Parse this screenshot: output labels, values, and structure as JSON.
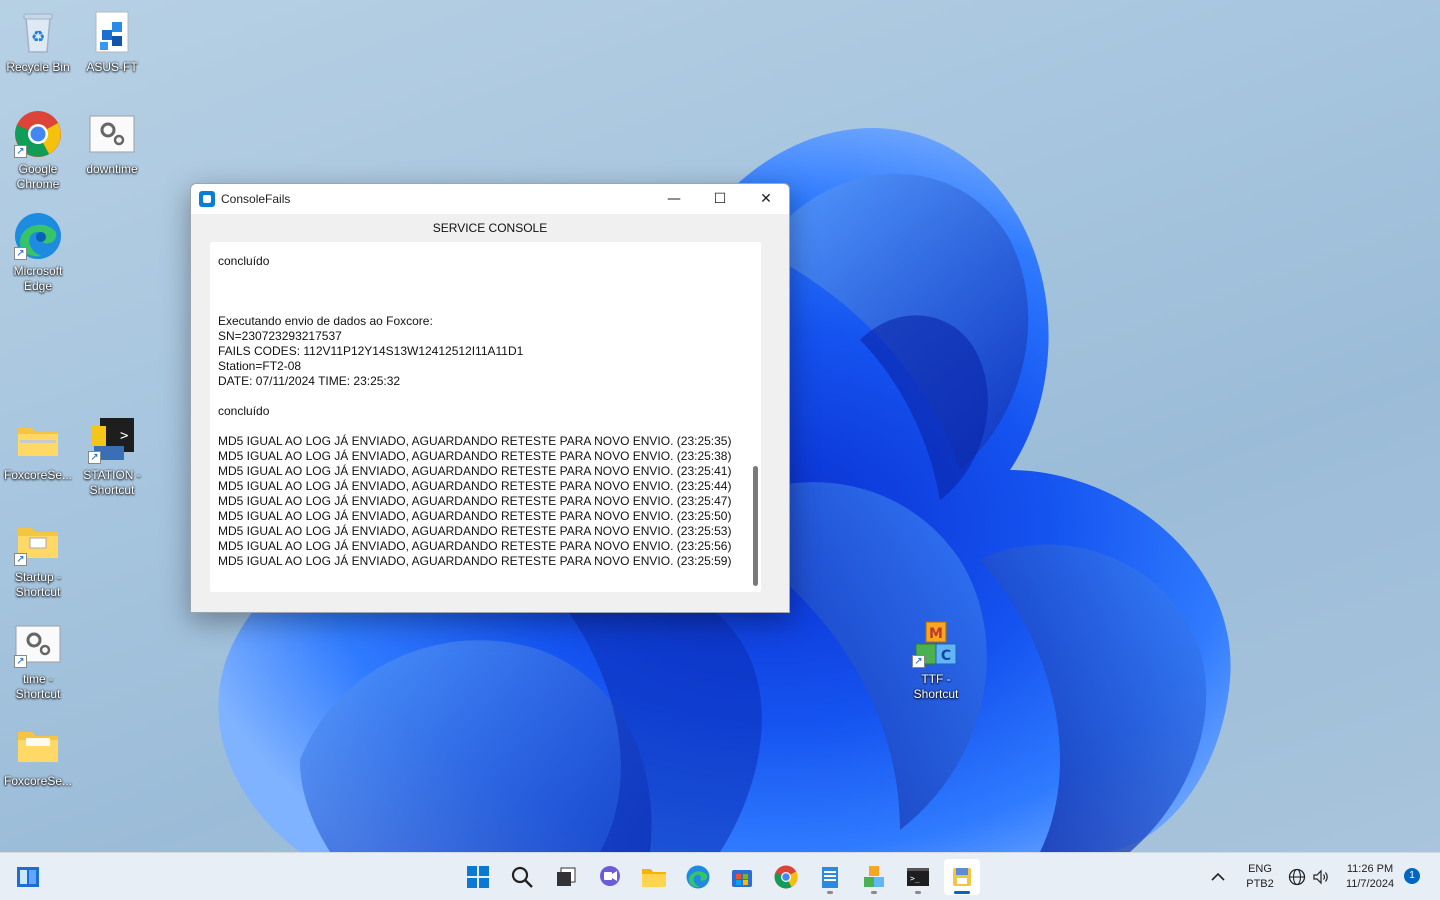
{
  "desktop": {
    "icons": [
      {
        "label": "Recycle Bin"
      },
      {
        "label": "ASUS-FT"
      },
      {
        "label": "Google Chrome"
      },
      {
        "label": "downtime"
      },
      {
        "label": "Microsoft Edge"
      },
      {
        "label": "FoxcoreSe..."
      },
      {
        "label": "STATION - Shortcut"
      },
      {
        "label": "Startup - Shortcut"
      },
      {
        "label": "time - Shortcut"
      },
      {
        "label": "FoxcoreSe..."
      },
      {
        "label": "TTF - Shortcut"
      }
    ]
  },
  "window": {
    "title": "ConsoleFails",
    "minimize_glyph": "—",
    "maximize_glyph": "☐",
    "close_glyph": "✕",
    "header": "SERVICE CONSOLE",
    "log_lines": [
      "concluído",
      "",
      "",
      "",
      "Executando envio de dados ao Foxcore:",
      "SN=230723293217537",
      "FAILS CODES: 112V11P12Y14S13W12412512I11A11D1",
      "Station=FT2-08",
      "DATE: 07/11/2024 TIME: 23:25:32",
      "",
      "concluído",
      "",
      "MD5 IGUAL AO LOG JÁ ENVIADO, AGUARDANDO RETESTE PARA NOVO ENVIO. (23:25:35)",
      "MD5 IGUAL AO LOG JÁ ENVIADO, AGUARDANDO RETESTE PARA NOVO ENVIO. (23:25:38)",
      "MD5 IGUAL AO LOG JÁ ENVIADO, AGUARDANDO RETESTE PARA NOVO ENVIO. (23:25:41)",
      "MD5 IGUAL AO LOG JÁ ENVIADO, AGUARDANDO RETESTE PARA NOVO ENVIO. (23:25:44)",
      "MD5 IGUAL AO LOG JÁ ENVIADO, AGUARDANDO RETESTE PARA NOVO ENVIO. (23:25:47)",
      "MD5 IGUAL AO LOG JÁ ENVIADO, AGUARDANDO RETESTE PARA NOVO ENVIO. (23:25:50)",
      "MD5 IGUAL AO LOG JÁ ENVIADO, AGUARDANDO RETESTE PARA NOVO ENVIO. (23:25:53)",
      "MD5 IGUAL AO LOG JÁ ENVIADO, AGUARDANDO RETESTE PARA NOVO ENVIO. (23:25:56)",
      "MD5 IGUAL AO LOG JÁ ENVIADO, AGUARDANDO RETESTE PARA NOVO ENVIO. (23:25:59)"
    ]
  },
  "taskbar": {
    "tray": {
      "language": "ENG",
      "layout": "PTB2",
      "time": "11:26 PM",
      "date": "11/7/2024",
      "notification_count": "1"
    }
  },
  "colors": {
    "accent": "#0067c0",
    "window_bg": "#f0f0f0",
    "log_bg": "#ffffff"
  }
}
